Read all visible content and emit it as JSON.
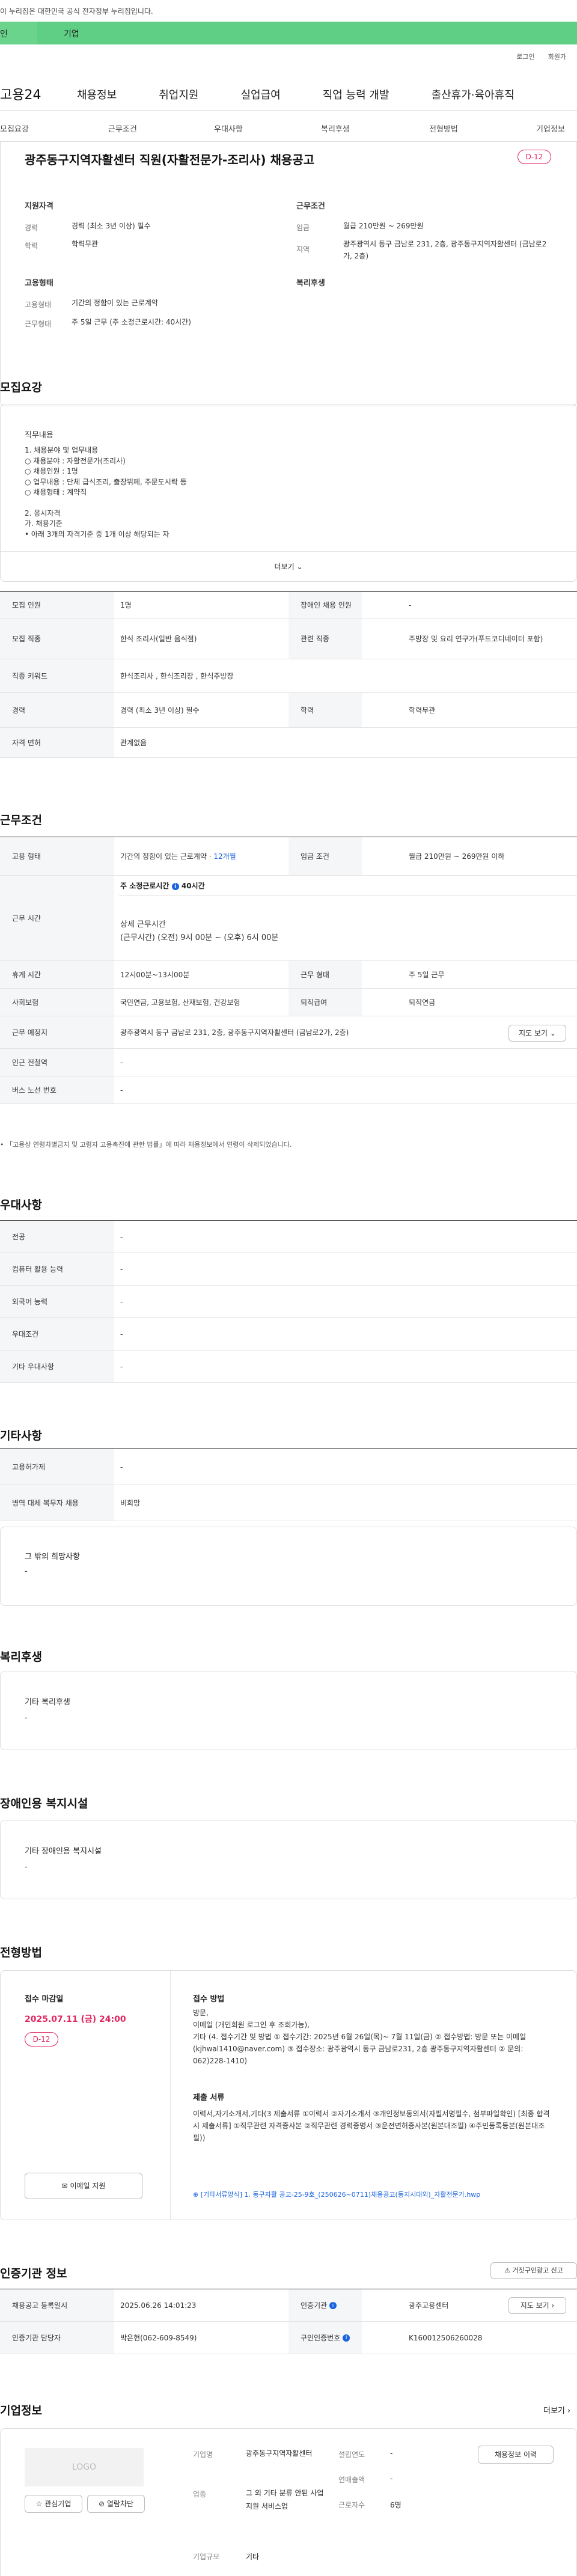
{
  "top_notice": "이 누리집은 대한민국 공식 전자정부 누리집입니다.",
  "gov_bar": {
    "left": "인",
    "tab": "기업"
  },
  "util": {
    "login": "로그인",
    "join": "회원가"
  },
  "logo": "고용24",
  "gnb": [
    "채용정보",
    "취업지원",
    "실업급여",
    "직업 능력 개발",
    "출산휴가·육아휴직"
  ],
  "tabs": [
    "모집요강",
    "근무조건",
    "우대사항",
    "복리후생",
    "전형방법",
    "기업정보"
  ],
  "job_title": "광주동구지역자활센터 직원(자활전문가-조리사) 채용공고",
  "dday": "D-12",
  "summary": {
    "qual_title": "지원자격",
    "career_k": "경력",
    "career_v": "경력 (최소 3년 이상) 필수",
    "edu_k": "학력",
    "edu_v": "학력무관",
    "cond_title": "근무조건",
    "wage_k": "임금",
    "wage_v": "월급 210만원 ~ 269만원",
    "area_k": "지역",
    "area_v": "광주광역시 동구 금남로 231, 2층, 광주동구지역자활센터 (금남로2가, 2층)",
    "emp_title": "고용형태",
    "emp_k": "고용형태",
    "emp_v": "기간의 정함이 있는 근로계약",
    "work_k": "근무형태",
    "work_v": "주 5일 근무 (주 소정근로시간: 40시간)",
    "welfare_title": "복리후생"
  },
  "recruit": {
    "section": "모집요강",
    "content_title": "직무내용",
    "content_lines": [
      "1. 채용분야 및 업무내용",
      "○ 채용분야 : 자활전문가(조리사)",
      "○ 채용인원 : 1명",
      "○ 업무내용 : 단체 급식조리, 출장뷔페, 주문도시락 등",
      "○ 채용형태 : 계약직",
      "",
      "2. 응시자격",
      "가. 채용기준",
      "• 아래 3개의 자격기준 중 1개 이상 해당되는 자"
    ],
    "more": "더보기",
    "rows": [
      {
        "k": "모집 인원",
        "v": "1명",
        "k2": "장애인 채용 인원",
        "v2": "-"
      },
      {
        "k": "모집 직종",
        "v": "한식 조리사(일반 음식점)",
        "k2": "관련 직종",
        "v2": "주방장 및 요리 연구가(푸드코디네이터 포함)"
      },
      {
        "k": "직종 키워드",
        "v": "한식조리사 , 한식조리장 , 한식주방장"
      },
      {
        "k": "경력",
        "v": "경력 (최소 3년 이상) 필수",
        "k2": "학력",
        "v2": "학력무관"
      },
      {
        "k": "자격 면허",
        "v": "관계없음"
      }
    ]
  },
  "work": {
    "section": "근무조건",
    "emp_k": "고용 형태",
    "emp_v": "기간의 정함이 있는 근로계약 ·",
    "emp_months": "12개월",
    "wage_k": "임금 조건",
    "wage_v": "월급 210만원 ~ 269만원 이하",
    "time_k": "근무 시간",
    "hours_label": "주 소정근로시간",
    "hours_val": "40시간",
    "detail_title": "상세 근무시간",
    "detail_v": "(근무시간) (오전) 9시 00분 ~ (오후) 6시 00분",
    "rest_k": "휴게 시간",
    "rest_v": "12시00분~13시00분",
    "type_k": "근무 형태",
    "type_v": "주 5일 근무",
    "ins_k": "사회보험",
    "ins_v": "국민연금, 고용보험, 산재보험, 건강보험",
    "ret_k": "퇴직급여",
    "ret_v": "퇴직연금",
    "place_k": "근무 예정지",
    "place_v": "광주광역시 동구 금남로 231, 2층, 광주동구지역자활센터 (금남로2가, 2층)",
    "map_btn": "지도 보기",
    "subway_k": "인근 전철역",
    "subway_v": "-",
    "bus_k": "버스 노선 번호",
    "bus_v": "-",
    "footnote": "「고용상 연령차별금지 및 고령자 고용촉진에 관한 법률」에 따라 채용정보에서 연령이 삭제되었습니다."
  },
  "pref": {
    "section": "우대사항",
    "rows": [
      {
        "k": "전공",
        "v": "-"
      },
      {
        "k": "컴퓨터 활용 능력",
        "v": "-"
      },
      {
        "k": "외국어 능력",
        "v": "-"
      },
      {
        "k": "우대조건",
        "v": "-"
      },
      {
        "k": "기타 우대사항",
        "v": "-"
      }
    ]
  },
  "etc": {
    "section": "기타사항",
    "rows": [
      {
        "k": "고용허가제",
        "v": "-"
      },
      {
        "k": "병역 대체 복무자 채용",
        "v": "비희망"
      }
    ],
    "other_title": "그 밖의 희망사항",
    "other_v": "-"
  },
  "welfare": {
    "section": "복리후생",
    "box_title": "기타 복리후생",
    "box_v": "-"
  },
  "disabled": {
    "section": "장애인용 복지시설",
    "box_title": "기타 장애인용 복지시설",
    "box_v": "-"
  },
  "screening": {
    "section": "전형방법",
    "deadline_title": "접수 마감일",
    "deadline": "2025.07.11 (금) 24:00",
    "dday": "D-12",
    "apply_btn": "이메일 지원",
    "method_title": "접수 방법",
    "method_v": "방문,\n이메일 (개인회원 로그인 후 조회가능),\n기타 (4. 접수기간 및 방법 ① 접수기간: 2025년 6월 26일(목)~ 7월 11일(금) ② 접수방법: 방문 또는 이메일(kjhwal1410@naver.com) ③ 접수장소: 광주광역시 동구 금남로231, 2층 광주동구지역자활센터 ② 문의: 062)228-1410)",
    "docs_title": "제출 서류",
    "docs_v": "이력서,자기소개서,기타(3 제출서류 ①이력서 ②자기소개서 ③개인정보동의서(자필서명필수, 첨부파일확인) [최종 합격시 제출서류] ①직무관련 자격증사본 ②직무관련 경력증명서 ③운전면허증사본(원본대조필) ④주민등록등본(원본대조필))",
    "file": "[기타서류양식] 1. 동구자활 공고-25-9호_(250626~0711)채용공고(동지시대외)_자활전문가.hwp"
  },
  "cert": {
    "section": "인증기관 정보",
    "report_btn": "거짓구인광고 신고",
    "reg_k": "채용공고 등록일시",
    "reg_v": "2025.06.26 14:01:23",
    "org_k": "인증기관",
    "org_v": "광주고용센터",
    "staff_k": "인증기관 담당자",
    "staff_v": "박은현(062-609-8549)",
    "no_k": "구인인증번호",
    "no_v": "K160012506260028",
    "map_btn": "지도 보기"
  },
  "company": {
    "section": "기업정보",
    "more": "더보기",
    "logo": "LOGO",
    "fav_btn": "관심기업",
    "block_btn": "열람차단",
    "name_k": "기업명",
    "name_v": "광주동구지역자활센터",
    "biz_k": "업종",
    "biz_v": "그 외 기타 분류 안된 사업지원 서비스업",
    "size_k": "기업규모",
    "size_v": "기타",
    "year_k": "설립연도",
    "year_v": "-",
    "sales_k": "연매출액",
    "sales_v": "-",
    "emp_k": "근로자수",
    "emp_v": "6명",
    "history_btn": "채용정보 이력"
  }
}
